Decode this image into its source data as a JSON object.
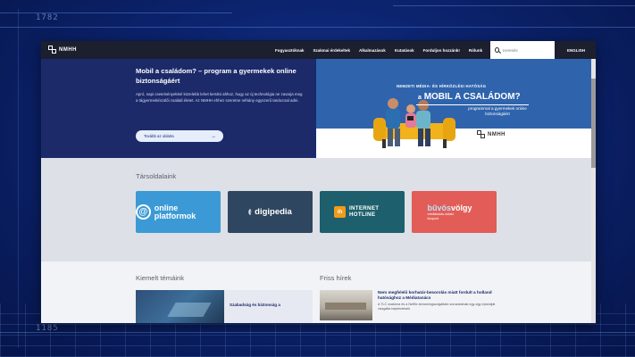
{
  "backdrop": {
    "number_top": "1782",
    "number_bottom": "1185"
  },
  "header": {
    "logo_text": "NMHH",
    "nav": [
      "Fogyasztóknak",
      "Szakmai érdekeltek",
      "Alkalmazások",
      "Kutatások",
      "Forduljon hozzánk!",
      "Rólunk"
    ],
    "search_placeholder": "Keresés",
    "language": "ENGLISH"
  },
  "hero": {
    "title": "Mobil a családom? – program a gyermekek online biztonságáért",
    "text": "Apró, napi csetelvényekkel közelebb lehet kerülni ahhoz, hogy az új technológia ne zavarja meg a tágyermeki/szülői családi életet. Az NMHH ehhez szeretne néhány egyszerű tanáccsal adni.",
    "button_label": "Tovább az oldalra",
    "button_arrow": "→",
    "banner": {
      "kicker": "NEMZETI MÉDIA- ÉS HÍRKÖZLÉSI HATÓSÁG",
      "title_prefix": "a",
      "title": "MOBIL A CSALÁDOM?",
      "subtitle": "programmal a gyermekek online biztonságáért",
      "logo_text": "NMHH"
    }
  },
  "partners": {
    "title": "Társoldalaink",
    "tiles": [
      {
        "text": "online platformok",
        "icon": "@"
      },
      {
        "text": "digipedia",
        "icon": "((·"
      },
      {
        "badge": "ih",
        "text": "INTERNET HOTLINE"
      },
      {
        "text_a": "bűvös",
        "text_b": "völgy",
        "sub": "médiatudás-oktató központ"
      }
    ]
  },
  "featured": {
    "title": "Kiemelt témáink",
    "card_title": "Szabadság és biztonság a"
  },
  "news": {
    "title": "Friss hírek",
    "items": [
      {
        "headline": "Nem megfelelő korhatár-besorolás miatt fordult a holland hatósághoz a Médiatanács",
        "excerpt": "A TLC csatorna és a Netflix streamingszolgáltató sorozatainak egy-egy epizódját vizsgálta bejelentések"
      }
    ]
  },
  "colors": {
    "header_bg": "#1b1f2e",
    "hero_bg": "#1c2a6a",
    "banner_blue": "#2f64ad",
    "tile_onlineplatformok": "#3b9ad6",
    "tile_digipedia": "#2f4660",
    "tile_hotline": "#1d5f6c",
    "tile_biztonsag": "#e25d57"
  }
}
